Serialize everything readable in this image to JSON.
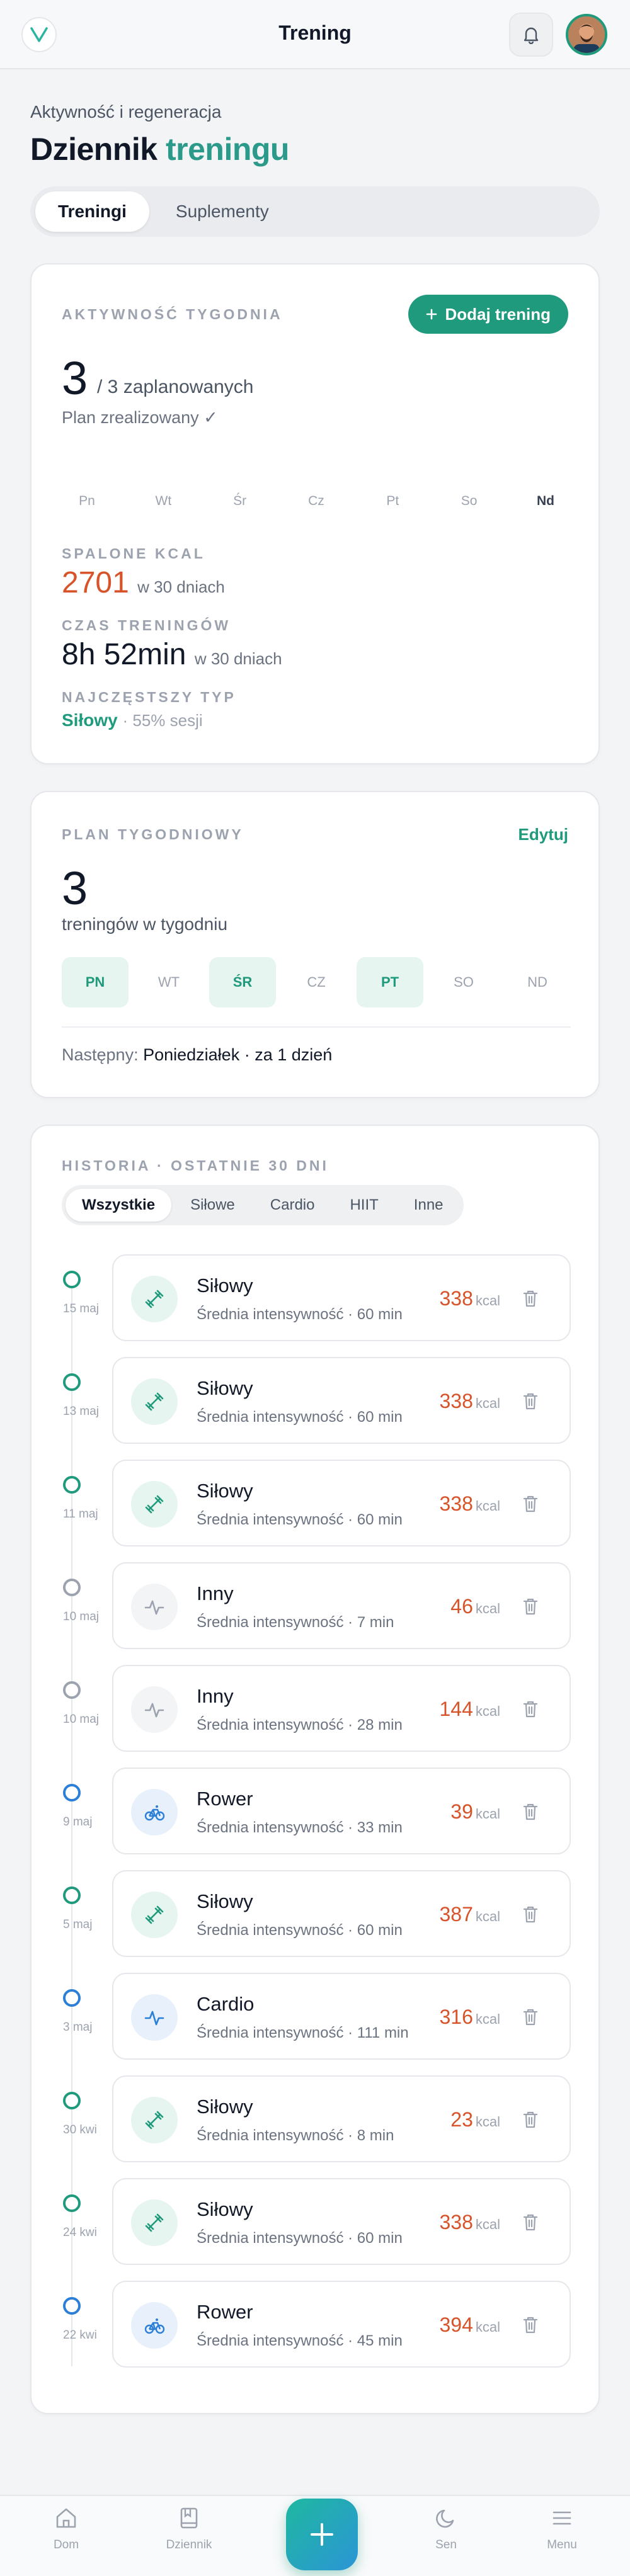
{
  "header": {
    "title": "Trening"
  },
  "intro": {
    "subtitle": "Aktywność i regeneracja",
    "title_main": "Dziennik ",
    "title_accent": "treningu"
  },
  "tabs": [
    {
      "label": "Treningi",
      "active": true
    },
    {
      "label": "Suplementy",
      "active": false
    }
  ],
  "weekly_activity": {
    "label": "AKTYWNOŚĆ TYGODNIA",
    "add_button": "Dodaj trening",
    "done": "3",
    "planned_text": "/ 3 zaplanowanych",
    "status": "Plan zrealizowany ✓",
    "days": [
      "Pn",
      "Wt",
      "Śr",
      "Cz",
      "Pt",
      "So",
      "Nd"
    ],
    "today_index": 6,
    "kcal_label": "SPALONE KCAL",
    "kcal_value": "2701",
    "kcal_unit": "w 30 dniach",
    "time_label": "CZAS TRENINGÓW",
    "time_value": "8h 52min",
    "time_unit": "w 30 dniach",
    "type_label": "NAJCZĘSTSZY TYP",
    "type_value": "Siłowy",
    "type_share": "· 55% sesji"
  },
  "weekly_plan": {
    "label": "PLAN TYGODNIOWY",
    "edit": "Edytuj",
    "count": "3",
    "count_label": "treningów w tygodniu",
    "days": [
      {
        "label": "PN",
        "on": true
      },
      {
        "label": "WT",
        "on": false
      },
      {
        "label": "ŚR",
        "on": true
      },
      {
        "label": "CZ",
        "on": false
      },
      {
        "label": "PT",
        "on": true
      },
      {
        "label": "SO",
        "on": false
      },
      {
        "label": "ND",
        "on": false
      }
    ],
    "next_label": "Następny:",
    "next_value": "Poniedziałek · za 1 dzień"
  },
  "history": {
    "label": "HISTORIA · OSTATNIE 30 DNI",
    "filters": [
      {
        "label": "Wszystkie",
        "active": true
      },
      {
        "label": "Siłowe",
        "active": false
      },
      {
        "label": "Cardio",
        "active": false
      },
      {
        "label": "HIIT",
        "active": false
      },
      {
        "label": "Inne",
        "active": false
      }
    ],
    "kcal_unit": "kcal",
    "entries": [
      {
        "date": "15 maj",
        "name": "Siłowy",
        "sub": "Średnia intensywność · 60 min",
        "kcal": "338",
        "kind": "strength"
      },
      {
        "date": "13 maj",
        "name": "Siłowy",
        "sub": "Średnia intensywność · 60 min",
        "kcal": "338",
        "kind": "strength"
      },
      {
        "date": "11 maj",
        "name": "Siłowy",
        "sub": "Średnia intensywność · 60 min",
        "kcal": "338",
        "kind": "strength"
      },
      {
        "date": "10 maj",
        "name": "Inny",
        "sub": "Średnia intensywność · 7 min",
        "kcal": "46",
        "kind": "other"
      },
      {
        "date": "10 maj",
        "name": "Inny",
        "sub": "Średnia intensywność · 28 min",
        "kcal": "144",
        "kind": "other"
      },
      {
        "date": "9 maj",
        "name": "Rower",
        "sub": "Średnia intensywność · 33 min",
        "kcal": "39",
        "kind": "bike"
      },
      {
        "date": "5 maj",
        "name": "Siłowy",
        "sub": "Średnia intensywność · 60 min",
        "kcal": "387",
        "kind": "strength"
      },
      {
        "date": "3 maj",
        "name": "Cardio",
        "sub": "Średnia intensywność · 111 min",
        "kcal": "316",
        "kind": "cardio"
      },
      {
        "date": "30 kwi",
        "name": "Siłowy",
        "sub": "Średnia intensywność · 8 min",
        "kcal": "23",
        "kind": "strength"
      },
      {
        "date": "24 kwi",
        "name": "Siłowy",
        "sub": "Średnia intensywność · 60 min",
        "kcal": "338",
        "kind": "strength"
      },
      {
        "date": "22 kwi",
        "name": "Rower",
        "sub": "Średnia intensywność · 45 min",
        "kcal": "394",
        "kind": "bike"
      }
    ]
  },
  "bottom_nav": [
    {
      "label": "Dom",
      "icon": "home-icon"
    },
    {
      "label": "Dziennik",
      "icon": "journal-icon"
    },
    {
      "label": "Sen",
      "icon": "moon-icon"
    },
    {
      "label": "Menu",
      "icon": "menu-icon"
    }
  ],
  "colors": {
    "accent": "#1f9a7c",
    "kcal": "#d7542b",
    "blue": "#2b7fd6",
    "gray": "#9ca3af"
  }
}
